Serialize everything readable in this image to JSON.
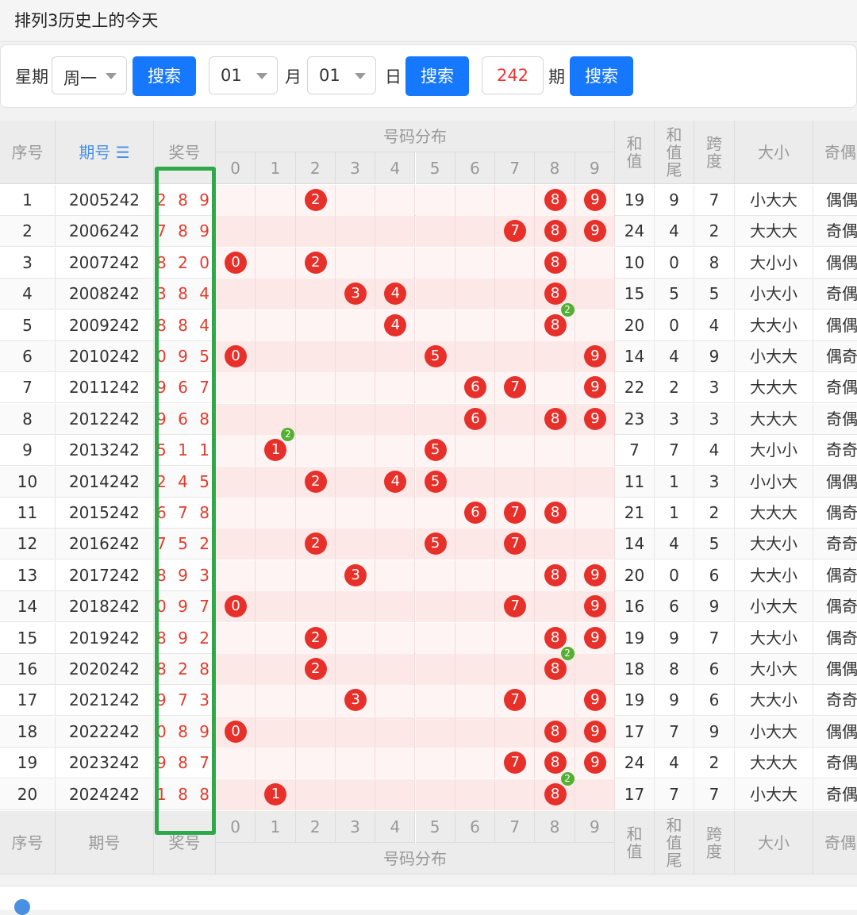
{
  "page_title": "排列3历史上的今天",
  "filters": {
    "weekday_label": "星期",
    "weekday_value": "周一",
    "search_label": "搜索",
    "month_value": "01",
    "month_label": "月",
    "day_value": "01",
    "day_label": "日",
    "period_value": "242",
    "period_label": "期"
  },
  "table": {
    "headers": {
      "index": "序号",
      "period": "期号",
      "prize": "奖号",
      "distribution": "号码分布",
      "sum": "和值",
      "sum_tail": "和值尾",
      "span": "跨度",
      "size": "大小",
      "parity": "奇偶"
    },
    "digits": [
      "0",
      "1",
      "2",
      "3",
      "4",
      "5",
      "6",
      "7",
      "8",
      "9"
    ],
    "rows": [
      {
        "idx": "1",
        "period": "2005242",
        "prize": "289",
        "sum": "19",
        "tail": "9",
        "span": "7",
        "size": "小大大",
        "parity": "偶偶奇",
        "balls": [
          2,
          8,
          9
        ],
        "repeat": {}
      },
      {
        "idx": "2",
        "period": "2006242",
        "prize": "789",
        "sum": "24",
        "tail": "4",
        "span": "2",
        "size": "大大大",
        "parity": "奇偶奇",
        "balls": [
          7,
          8,
          9
        ],
        "repeat": {}
      },
      {
        "idx": "3",
        "period": "2007242",
        "prize": "820",
        "sum": "10",
        "tail": "0",
        "span": "8",
        "size": "大小小",
        "parity": "偶偶偶",
        "balls": [
          0,
          2,
          8
        ],
        "repeat": {}
      },
      {
        "idx": "4",
        "period": "2008242",
        "prize": "384",
        "sum": "15",
        "tail": "5",
        "span": "5",
        "size": "小大小",
        "parity": "奇偶偶",
        "balls": [
          3,
          4,
          8
        ],
        "repeat": {}
      },
      {
        "idx": "5",
        "period": "2009242",
        "prize": "884",
        "sum": "20",
        "tail": "0",
        "span": "4",
        "size": "大大小",
        "parity": "偶偶偶",
        "balls": [
          4,
          8
        ],
        "repeat": {
          "8": "2"
        }
      },
      {
        "idx": "6",
        "period": "2010242",
        "prize": "095",
        "sum": "14",
        "tail": "4",
        "span": "9",
        "size": "小大大",
        "parity": "偶奇奇",
        "balls": [
          0,
          5,
          9
        ],
        "repeat": {}
      },
      {
        "idx": "7",
        "period": "2011242",
        "prize": "967",
        "sum": "22",
        "tail": "2",
        "span": "3",
        "size": "大大大",
        "parity": "奇偶奇",
        "balls": [
          6,
          7,
          9
        ],
        "repeat": {}
      },
      {
        "idx": "8",
        "period": "2012242",
        "prize": "968",
        "sum": "23",
        "tail": "3",
        "span": "3",
        "size": "大大大",
        "parity": "奇偶偶",
        "balls": [
          6,
          8,
          9
        ],
        "repeat": {}
      },
      {
        "idx": "9",
        "period": "2013242",
        "prize": "511",
        "sum": "7",
        "tail": "7",
        "span": "4",
        "size": "大小小",
        "parity": "奇奇奇",
        "balls": [
          1,
          5
        ],
        "repeat": {
          "1": "2"
        }
      },
      {
        "idx": "10",
        "period": "2014242",
        "prize": "245",
        "sum": "11",
        "tail": "1",
        "span": "3",
        "size": "小小大",
        "parity": "偶偶奇",
        "balls": [
          2,
          4,
          5
        ],
        "repeat": {}
      },
      {
        "idx": "11",
        "period": "2015242",
        "prize": "678",
        "sum": "21",
        "tail": "1",
        "span": "2",
        "size": "大大大",
        "parity": "偶奇偶",
        "balls": [
          6,
          7,
          8
        ],
        "repeat": {}
      },
      {
        "idx": "12",
        "period": "2016242",
        "prize": "752",
        "sum": "14",
        "tail": "4",
        "span": "5",
        "size": "大大小",
        "parity": "奇奇偶",
        "balls": [
          2,
          5,
          7
        ],
        "repeat": {}
      },
      {
        "idx": "13",
        "period": "2017242",
        "prize": "893",
        "sum": "20",
        "tail": "0",
        "span": "6",
        "size": "大大小",
        "parity": "偶奇奇",
        "balls": [
          3,
          8,
          9
        ],
        "repeat": {}
      },
      {
        "idx": "14",
        "period": "2018242",
        "prize": "097",
        "sum": "16",
        "tail": "6",
        "span": "9",
        "size": "小大大",
        "parity": "偶奇奇",
        "balls": [
          0,
          7,
          9
        ],
        "repeat": {}
      },
      {
        "idx": "15",
        "period": "2019242",
        "prize": "892",
        "sum": "19",
        "tail": "9",
        "span": "7",
        "size": "大大小",
        "parity": "偶奇偶",
        "balls": [
          2,
          8,
          9
        ],
        "repeat": {}
      },
      {
        "idx": "16",
        "period": "2020242",
        "prize": "828",
        "sum": "18",
        "tail": "8",
        "span": "6",
        "size": "大小大",
        "parity": "偶偶偶",
        "balls": [
          2,
          8
        ],
        "repeat": {
          "8": "2"
        }
      },
      {
        "idx": "17",
        "period": "2021242",
        "prize": "973",
        "sum": "19",
        "tail": "9",
        "span": "6",
        "size": "大大小",
        "parity": "奇奇奇",
        "balls": [
          3,
          7,
          9
        ],
        "repeat": {}
      },
      {
        "idx": "18",
        "period": "2022242",
        "prize": "089",
        "sum": "17",
        "tail": "7",
        "span": "9",
        "size": "小大大",
        "parity": "偶偶奇",
        "balls": [
          0,
          8,
          9
        ],
        "repeat": {}
      },
      {
        "idx": "19",
        "period": "2023242",
        "prize": "987",
        "sum": "24",
        "tail": "4",
        "span": "2",
        "size": "大大大",
        "parity": "奇偶奇",
        "balls": [
          7,
          8,
          9
        ],
        "repeat": {}
      },
      {
        "idx": "20",
        "period": "2024242",
        "prize": "188",
        "sum": "17",
        "tail": "7",
        "span": "7",
        "size": "小大大",
        "parity": "奇偶偶",
        "balls": [
          1,
          8
        ],
        "repeat": {
          "8": "2"
        }
      }
    ]
  },
  "colors": {
    "accent": "#1677ff",
    "ball": "#e8302a",
    "repeat_badge": "#53b032",
    "highlight_box": "#2fa84a"
  }
}
